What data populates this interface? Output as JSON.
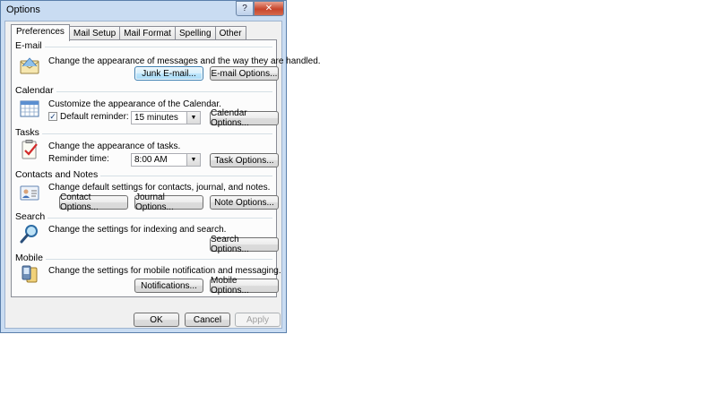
{
  "window": {
    "title": "Options",
    "help_glyph": "?",
    "close_glyph": "✕"
  },
  "tabs": [
    {
      "label": "Preferences",
      "active": true
    },
    {
      "label": "Mail Setup"
    },
    {
      "label": "Mail Format"
    },
    {
      "label": "Spelling"
    },
    {
      "label": "Other"
    }
  ],
  "sections": {
    "email": {
      "label": "E-mail",
      "description": "Change the appearance of messages and the way they are handled.",
      "junk_button": "Junk E-mail...",
      "options_button": "E-mail Options..."
    },
    "calendar": {
      "label": "Calendar",
      "description": "Customize the appearance of the Calendar.",
      "reminder_label": "Default reminder:",
      "reminder_checked": true,
      "reminder_value": "15 minutes",
      "options_button": "Calendar Options..."
    },
    "tasks": {
      "label": "Tasks",
      "description": "Change the appearance of tasks.",
      "reminder_label": "Reminder time:",
      "reminder_value": "8:00 AM",
      "options_button": "Task Options..."
    },
    "contacts": {
      "label": "Contacts and Notes",
      "description": "Change default settings for contacts, journal, and notes.",
      "contact_button": "Contact Options...",
      "journal_button": "Journal Options...",
      "note_button": "Note Options..."
    },
    "search": {
      "label": "Search",
      "description": "Change the settings for indexing and search.",
      "options_button": "Search Options..."
    },
    "mobile": {
      "label": "Mobile",
      "description": "Change the settings for mobile notification and messaging.",
      "notifications_button": "Notifications...",
      "options_button": "Mobile Options..."
    }
  },
  "footer": {
    "ok": "OK",
    "cancel": "Cancel",
    "apply": "Apply"
  },
  "colors": {
    "accent": "#3c7fb1",
    "frame": "#c9dcf2",
    "close": "#c7452b"
  }
}
